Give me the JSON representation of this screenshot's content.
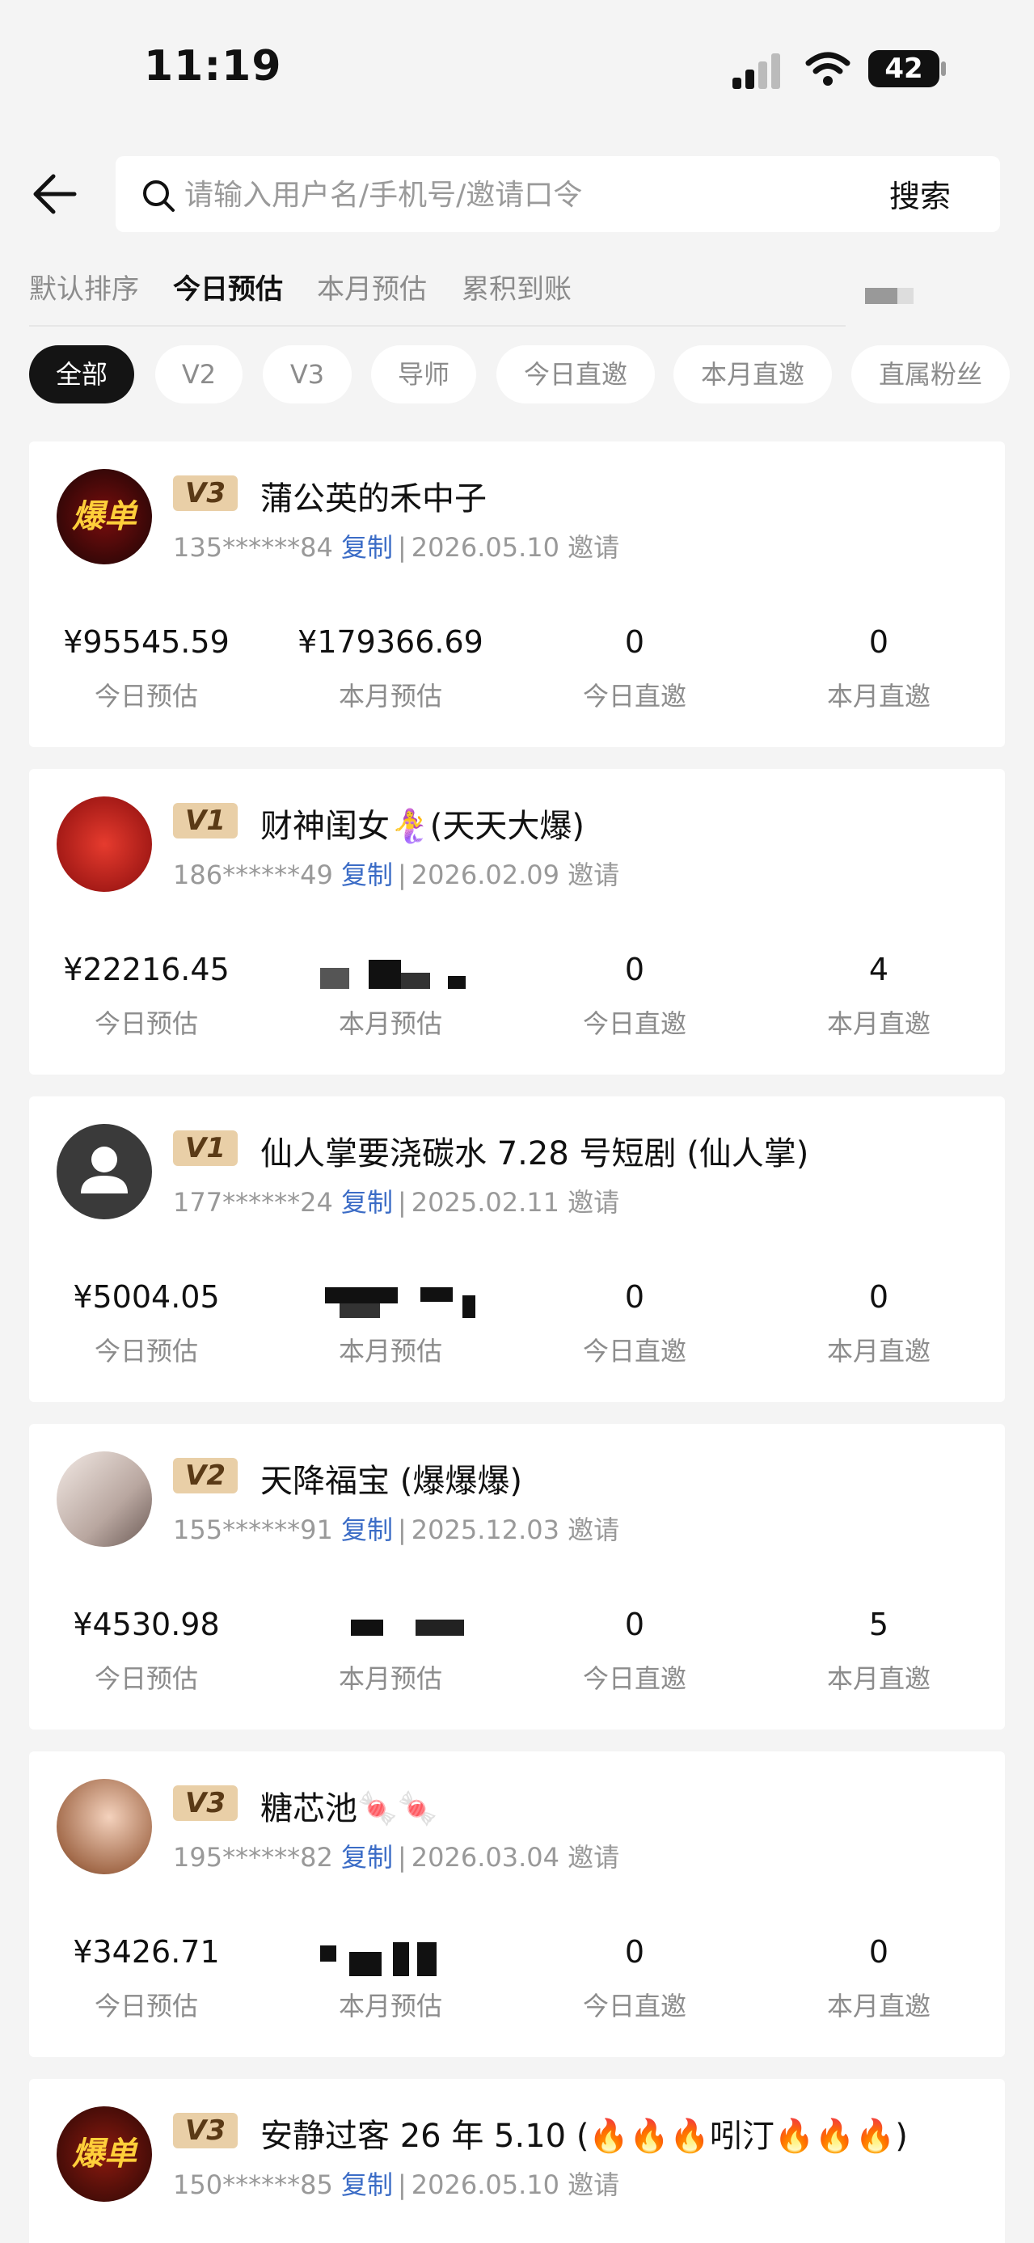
{
  "status_bar": {
    "time": "11:19",
    "battery": "42"
  },
  "search": {
    "placeholder": "请输入用户名/手机号/邀请口令",
    "button_label": "搜索"
  },
  "sort_tabs": [
    "默认排序",
    "今日预估",
    "本月预估",
    "累积到账"
  ],
  "sort_active_index": 1,
  "filter_chips": [
    "全部",
    "V2",
    "V3",
    "导师",
    "今日直邀",
    "本月直邀",
    "直属粉丝"
  ],
  "filter_active_index": 0,
  "copy_label": "复制",
  "stat_labels": {
    "today_est": "今日预估",
    "month_est": "本月预估",
    "today_invite": "今日直邀",
    "month_invite": "本月直邀"
  },
  "members": [
    {
      "level": "V3",
      "name": "蒲公英的禾中子",
      "phone": "135******84",
      "invite_date": "2026.05.10 邀请",
      "today_est": "¥95545.59",
      "month_est": "¥179366.69",
      "today_invite": "0",
      "month_invite": "0",
      "avatar_text": "爆单"
    },
    {
      "level": "V1",
      "name": "财神闺女🧜‍♀️(天天大爆)",
      "phone": "186******49",
      "invite_date": "2026.02.09 邀请",
      "today_est": "¥22216.45",
      "month_est": "",
      "today_invite": "0",
      "month_invite": "4",
      "avatar_text": ""
    },
    {
      "level": "V1",
      "name": "仙人掌要浇碳水 7.28 号短剧 (仙人掌)",
      "phone": "177******24",
      "invite_date": "2025.02.11 邀请",
      "today_est": "¥5004.05",
      "month_est": "",
      "today_invite": "0",
      "month_invite": "0",
      "avatar_text": ""
    },
    {
      "level": "V2",
      "name": "天降福宝 (爆爆爆)",
      "phone": "155******91",
      "invite_date": "2025.12.03 邀请",
      "today_est": "¥4530.98",
      "month_est": "",
      "today_invite": "0",
      "month_invite": "5",
      "avatar_text": ""
    },
    {
      "level": "V3",
      "name": "糖芯池🍬🍬",
      "phone": "195******82",
      "invite_date": "2026.03.04 邀请",
      "today_est": "¥3426.71",
      "month_est": "",
      "today_invite": "0",
      "month_invite": "0",
      "avatar_text": ""
    },
    {
      "level": "V3",
      "name": "安静过客 26 年 5.10 (🔥🔥🔥吲汀🔥🔥🔥)",
      "phone": "150******85",
      "invite_date": "2026.05.10 邀请",
      "today_est": "",
      "month_est": "",
      "today_invite": "",
      "month_invite": "",
      "avatar_text": "爆单"
    }
  ]
}
